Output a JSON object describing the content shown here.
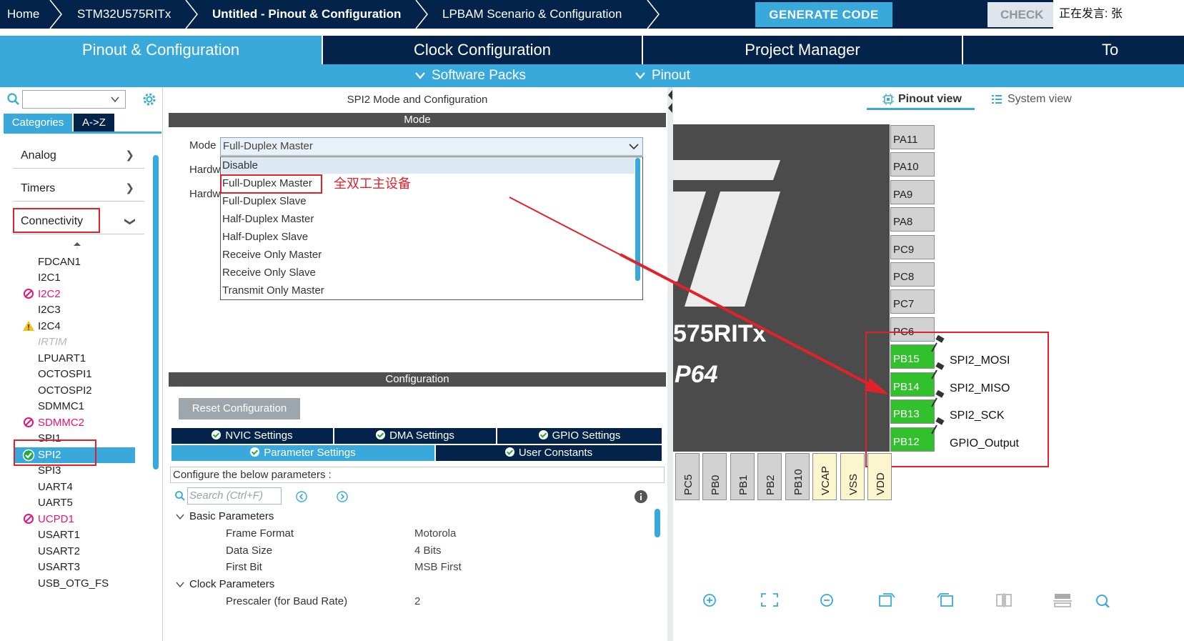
{
  "topbar": {
    "crumbs": [
      "Home",
      "STM32U575RITx",
      "Untitled - Pinout & Configuration",
      "LPBAM Scenario & Configuration"
    ],
    "generate_label": "GENERATE CODE",
    "check_label": "CHECK",
    "speaking_text": "正在发言: 张"
  },
  "tabs": {
    "main": [
      "Pinout & Configuration",
      "Clock Configuration",
      "Project Manager",
      "To"
    ],
    "sub": [
      "Software Packs",
      "Pinout"
    ]
  },
  "sidebar": {
    "categories_tab": "Categories",
    "az_tab": "A->Z",
    "groups": [
      "Analog",
      "Timers",
      "Connectivity"
    ],
    "peripherals": [
      "FDCAN1",
      "I2C1",
      "I2C2",
      "I2C3",
      "I2C4",
      "IRTIM",
      "LPUART1",
      "OCTOSPI1",
      "OCTOSPI2",
      "SDMMC1",
      "SDMMC2",
      "SPI1",
      "SPI2",
      "SPI3",
      "UART4",
      "UART5",
      "UCPD1",
      "USART1",
      "USART2",
      "USART3",
      "USB_OTG_FS"
    ]
  },
  "mode_panel": {
    "title": "SPI2 Mode and Configuration",
    "section": "Mode",
    "mode_label": "Mode",
    "mode_value": "Full-Duplex Master",
    "hw_label_1": "Hardw",
    "hw_label_2": "Hardw",
    "options": [
      "Disable",
      "Full-Duplex Master",
      "Full-Duplex Slave",
      "Half-Duplex Master",
      "Half-Duplex Slave",
      "Receive Only Master",
      "Receive Only Slave",
      "Transmit Only Master"
    ],
    "annotation": "全双工主设备"
  },
  "config_panel": {
    "section": "Configuration",
    "reset_label": "Reset Configuration",
    "tabs_row1": [
      "NVIC Settings",
      "DMA Settings",
      "GPIO Settings"
    ],
    "tabs_row2": [
      "Parameter Settings",
      "User Constants"
    ],
    "hint": "Configure the below parameters :",
    "search_placeholder": "Search (Ctrl+F)",
    "groups": [
      "Basic Parameters",
      "Clock Parameters"
    ],
    "params": [
      {
        "name": "Frame Format",
        "value": "Motorola"
      },
      {
        "name": "Data Size",
        "value": "4 Bits"
      },
      {
        "name": "First Bit",
        "value": "MSB First"
      },
      {
        "name": "Prescaler (for Baud Rate)",
        "value": "2"
      }
    ]
  },
  "pinout": {
    "pinout_view": "Pinout view",
    "system_view": "System view",
    "chip_name": "575RITx",
    "chip_package": "P64",
    "right_pins": [
      "PA11",
      "PA10",
      "PA9",
      "PA8",
      "PC9",
      "PC8",
      "PC7",
      "PC6",
      "PB15",
      "PB14",
      "PB13",
      "PB12"
    ],
    "bottom_pins": [
      "PC5",
      "PB0",
      "PB1",
      "PB2",
      "PB10",
      "VCAP",
      "VSS",
      "VDD"
    ],
    "signals": [
      "SPI2_MOSI",
      "SPI2_MISO",
      "SPI2_SCK",
      "GPIO_Output"
    ]
  },
  "colors": {
    "navy": "#03234b",
    "accent": "#39a9dc",
    "pin_green": "#31c12c",
    "annotation_red": "#e1222a",
    "error_pink": "#e0157a"
  }
}
